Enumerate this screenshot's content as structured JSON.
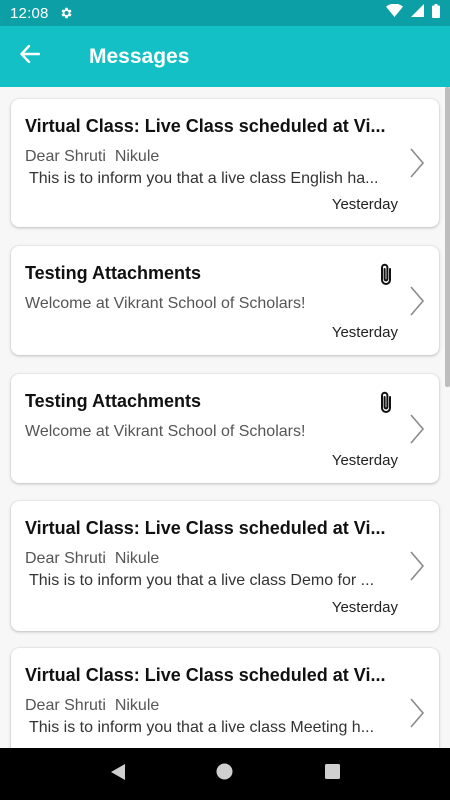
{
  "status_bar": {
    "time": "12:08"
  },
  "app_bar": {
    "title": "Messages"
  },
  "messages": [
    {
      "title": "Virtual Class: Live Class scheduled at Vi...",
      "line1": "Dear Shruti  Nikule",
      "line2": "This is to inform you that a live class English ha...",
      "date": "Yesterday",
      "has_attachment": false
    },
    {
      "title": "Testing Attachments",
      "line1": "Welcome at Vikrant School of Scholars!",
      "line2": "",
      "date": "Yesterday",
      "has_attachment": true
    },
    {
      "title": "Testing Attachments",
      "line1": "Welcome at Vikrant School of Scholars!",
      "line2": "",
      "date": "Yesterday",
      "has_attachment": true
    },
    {
      "title": "Virtual Class: Live Class scheduled at Vi...",
      "line1": "Dear Shruti  Nikule",
      "line2": "This is to inform you that a live class Demo for ...",
      "date": "Yesterday",
      "has_attachment": false
    },
    {
      "title": "Virtual Class: Live Class scheduled at Vi...",
      "line1": "Dear Shruti  Nikule",
      "line2": "This is to inform you that a live class Meeting h...",
      "date": "",
      "has_attachment": false
    }
  ],
  "icons": {
    "back": "arrow-left-icon",
    "chevron": "chevron-right-icon",
    "attachment": "paperclip-icon",
    "nav_back": "triangle-back-icon",
    "nav_home": "circle-home-icon",
    "nav_recents": "square-recents-icon"
  },
  "colors": {
    "status_bar": "#0d9fa6",
    "app_bar": "#13c0c6",
    "background": "#f7f7f7",
    "card": "#ffffff"
  }
}
